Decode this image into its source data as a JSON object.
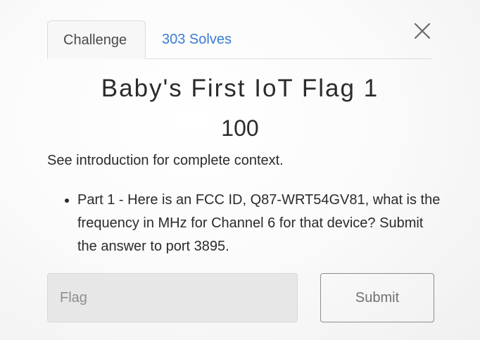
{
  "tabs": [
    {
      "label": "Challenge",
      "active": true
    },
    {
      "label": "303 Solves",
      "active": false
    }
  ],
  "close_icon": "close-icon",
  "challenge": {
    "title": "Baby's First IoT Flag 1",
    "points": "100",
    "intro": "See introduction for complete context.",
    "bullets": [
      "Part 1 - Here is an FCC ID, Q87-WRT54GV81, what is the frequency in MHz for Channel 6 for that device? Submit the answer to port 3895."
    ]
  },
  "form": {
    "flag_placeholder": "Flag",
    "flag_value": "",
    "submit_label": "Submit"
  },
  "colors": {
    "link": "#3a7bd5",
    "text": "#2b2b2b",
    "input_bg": "#e7e7e7"
  }
}
